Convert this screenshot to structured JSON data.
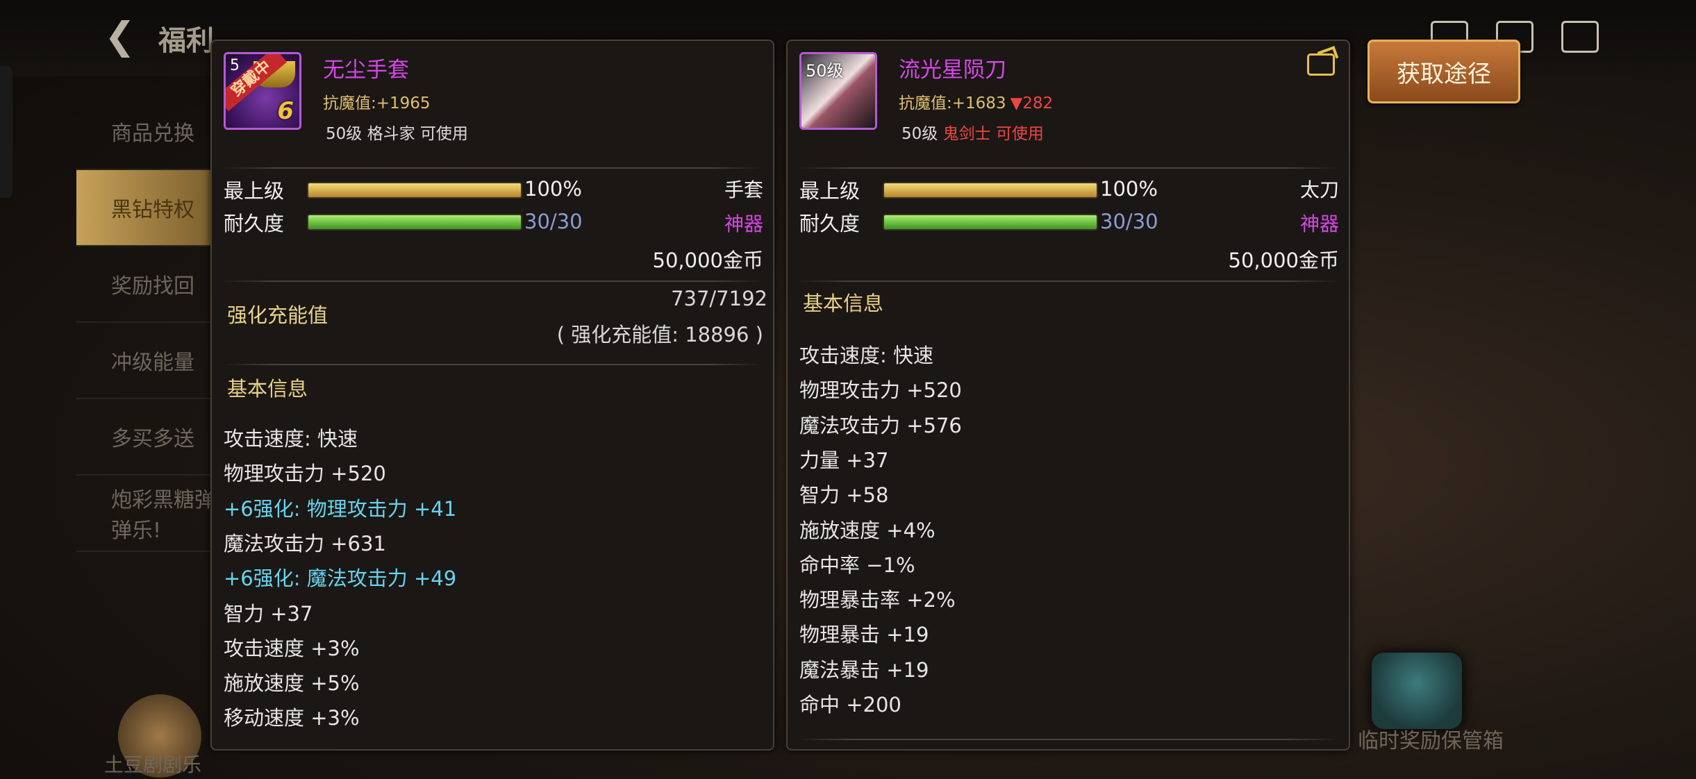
{
  "background": {
    "title": "福利",
    "menu": [
      "商品兑换",
      "黑钻特权",
      "奖励找回",
      "冲级能量",
      "多买多送",
      "炮彩黑糖弹弹乐!"
    ],
    "chest_label": "临时奖励保管箱",
    "avatar_label": "土豆剧剧乐"
  },
  "left_item": {
    "icon_level": "5",
    "equipped_label": "穿戴中",
    "enhance_level": "6",
    "name": "无尘手套",
    "resist_label": "抗魔值:",
    "resist_value": "+1965",
    "level": "50级",
    "class": "格斗家",
    "usable": "可使用",
    "grade_label": "最上级",
    "grade_value": "100%",
    "grade_fill": 1.0,
    "type": "手套",
    "durability_label": "耐久度",
    "durability_value": "30/30",
    "durability_fill": 1.0,
    "rarity": "神器",
    "price": "50,000金币",
    "charge_title": "强化充能值",
    "charge_value": "737/7192",
    "charge_sub": "( 强化充能值: 18896 )",
    "basic_info_title": "基本信息",
    "attributes": [
      {
        "text": "攻击速度: 快速",
        "style": "normal"
      },
      {
        "text": "物理攻击力 +520",
        "style": "normal"
      },
      {
        "text": "+6强化: 物理攻击力 +41",
        "style": "cyan"
      },
      {
        "text": "魔法攻击力 +631",
        "style": "normal"
      },
      {
        "text": "+6强化: 魔法攻击力 +49",
        "style": "cyan"
      },
      {
        "text": "智力 +37",
        "style": "normal"
      },
      {
        "text": "攻击速度 +3%",
        "style": "normal"
      },
      {
        "text": "施放速度 +5%",
        "style": "normal"
      },
      {
        "text": "移动速度 +3%",
        "style": "normal"
      }
    ]
  },
  "right_item": {
    "icon_level": "50级",
    "name": "流光星陨刀",
    "resist_label": "抗魔值:",
    "resist_value": "+1683",
    "resist_diff": "▼282",
    "level": "50级",
    "class": "鬼剑士",
    "usable": "可使用",
    "grade_label": "最上级",
    "grade_value": "100%",
    "grade_fill": 1.0,
    "type": "太刀",
    "durability_label": "耐久度",
    "durability_value": "30/30",
    "durability_fill": 1.0,
    "rarity": "神器",
    "price": "50,000金币",
    "basic_info_title": "基本信息",
    "attributes": [
      "攻击速度: 快速",
      "物理攻击力 +520",
      "魔法攻击力 +576",
      "力量 +37",
      "智力 +58",
      "施放速度 +4%",
      "命中率 −1%",
      "物理暴击率 +2%",
      "物理暴击 +19",
      "魔法暴击 +19",
      "命中 +200"
    ]
  },
  "acquire_button": "获取途径",
  "colors": {
    "epic_name": "#d646e8",
    "enhance_cyan": "#66d4f0",
    "section_gold": "#e9d28a",
    "button_orange": "#c7793a"
  }
}
